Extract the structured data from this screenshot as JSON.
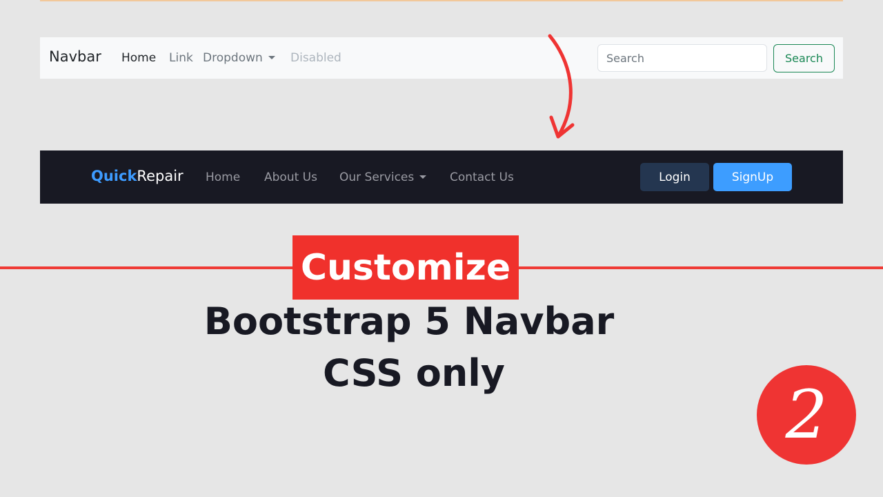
{
  "light_navbar": {
    "brand": "Navbar",
    "links": [
      "Home",
      "Link",
      "Dropdown",
      "Disabled"
    ],
    "search_placeholder": "Search",
    "search_button": "Search"
  },
  "dark_navbar": {
    "brand_accent": "Quick",
    "brand_rest": "Repair",
    "links": [
      "Home",
      "About Us",
      "Our Services",
      "Contact Us"
    ],
    "login_button": "Login",
    "signup_button": "SignUp"
  },
  "title": {
    "highlight": "Customize",
    "line1": "Bootstrap 5 Navbar",
    "line2": "CSS only"
  },
  "badge_number": "2",
  "colors": {
    "accent_red": "#ef3433",
    "brand_blue": "#3d9bff",
    "dark_bg": "#181923",
    "outline_green": "#198754"
  }
}
